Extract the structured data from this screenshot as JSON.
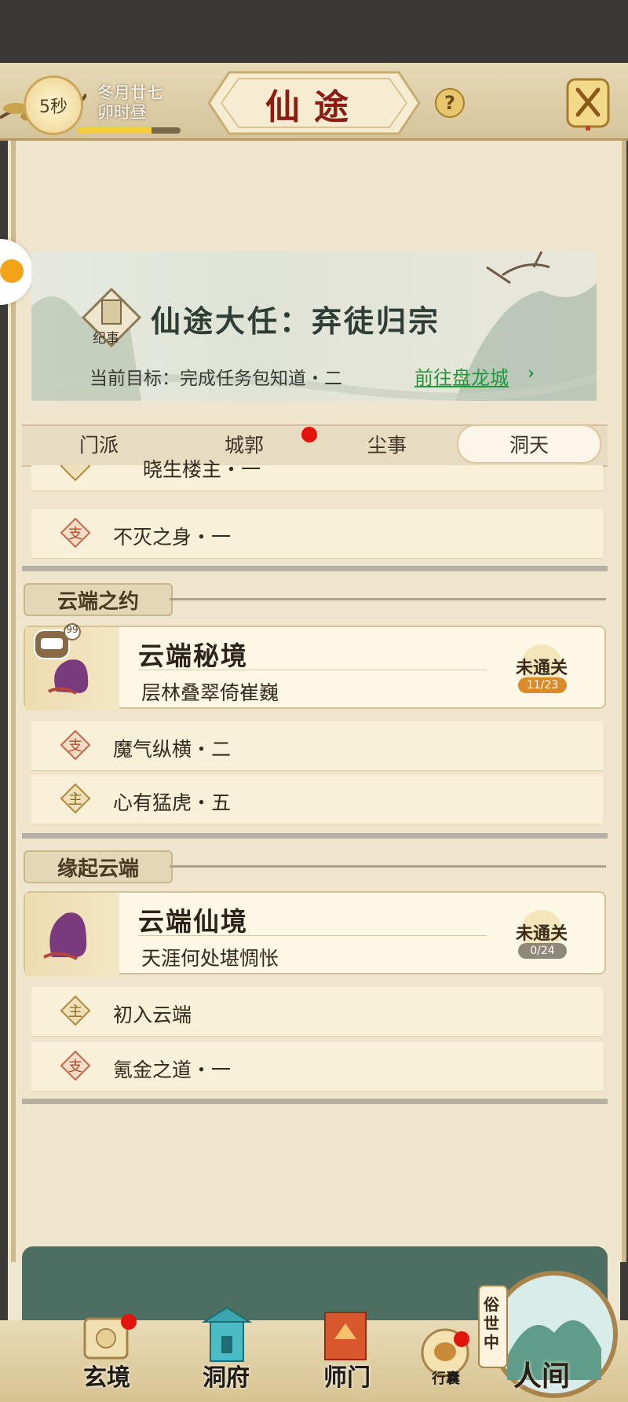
{
  "header": {
    "timer": "5秒",
    "date_line1": "冬月廿七",
    "date_line2": "卯时昼",
    "time_progress": 0.72,
    "title": "仙途",
    "help_label": "?"
  },
  "banner": {
    "seal_label": "纪事",
    "quest_title": "仙途大任：弃徒归宗",
    "goal_label": "当前目标：完成任务包知道・二",
    "goal_link": "前往盘龙城"
  },
  "tabs": [
    {
      "label": "门派",
      "active": false
    },
    {
      "label": "城郭",
      "active": false,
      "dot": true
    },
    {
      "label": "尘事",
      "active": false
    },
    {
      "label": "洞天",
      "active": true
    }
  ],
  "list_top": [
    {
      "tag": "主",
      "text": "晓生楼主・一"
    },
    {
      "tag": "支",
      "text": "不灭之身・一"
    }
  ],
  "section1": {
    "heading": "云端之约",
    "card": {
      "title": "云端秘境",
      "subtitle": "层林叠翠倚崔巍",
      "status": "未通关",
      "count": "11/23",
      "chat_count": "99"
    },
    "items": [
      {
        "tag": "支",
        "text": "魔气纵横・二"
      },
      {
        "tag": "主",
        "text": "心有猛虎・五"
      }
    ]
  },
  "section2": {
    "heading": "缘起云端",
    "card": {
      "title": "云端仙境",
      "subtitle": "天涯何处堪惆怅",
      "status": "未通关",
      "count": "0/24"
    },
    "items": [
      {
        "tag": "主",
        "text": "初入云端"
      },
      {
        "tag": "支",
        "text": "氪金之道・一"
      }
    ]
  },
  "bottom_nav": {
    "xuanjing": "玄境",
    "dongfu": "洞府",
    "shimen": "师门",
    "xingnang": "行囊",
    "suishizhong": "俗世中",
    "renjian": "人间"
  },
  "colors": {
    "title_red": "#8b1d12",
    "link_green": "#1e9a3a",
    "notify_red": "#e2140d"
  }
}
